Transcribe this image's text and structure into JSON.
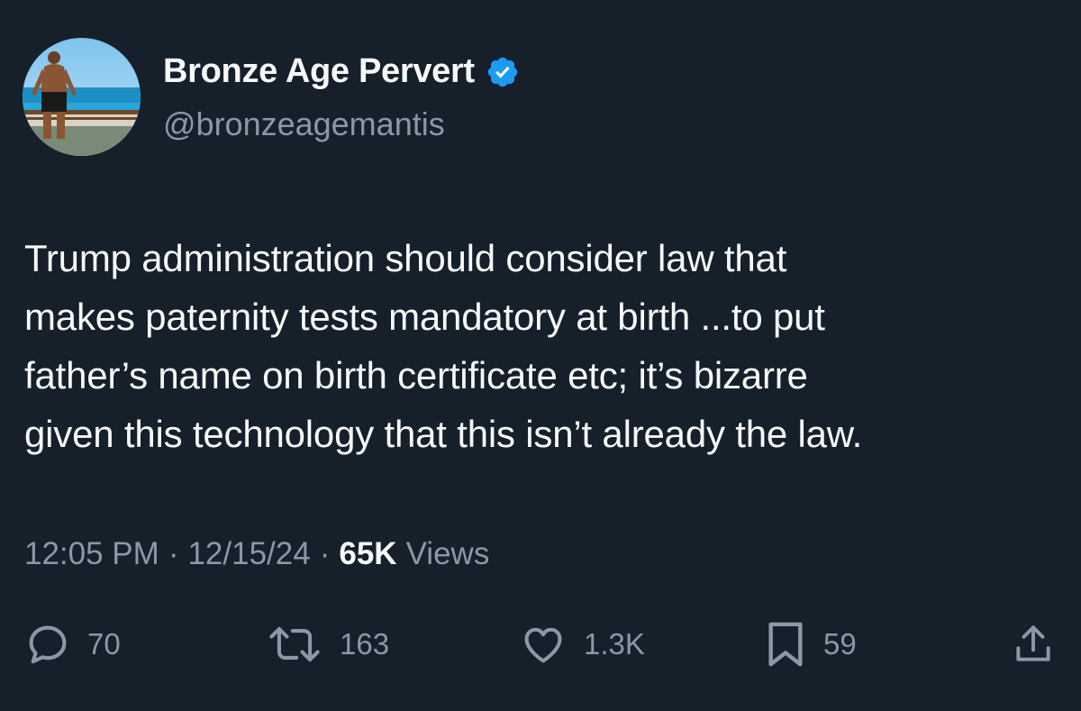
{
  "author": {
    "display_name": "Bronze Age Pervert",
    "handle": "@bronzeagemantis",
    "verified": true
  },
  "tweet": {
    "text": "Trump administration should consider law that\nmakes paternity tests mandatory at birth ...to put\nfather’s name on birth certificate etc; it’s bizarre\ngiven this technology that this isn’t already the law."
  },
  "meta": {
    "time": "12:05 PM",
    "separator": "·",
    "date": "12/15/24",
    "views_count": "65K",
    "views_label": "Views"
  },
  "actions": {
    "replies": "70",
    "reposts": "163",
    "likes": "1.3K",
    "bookmarks": "59"
  },
  "colors": {
    "background": "#15202b",
    "text": "#f7f9f9",
    "secondary": "#8b98a5",
    "verified": "#1d9bf0"
  }
}
